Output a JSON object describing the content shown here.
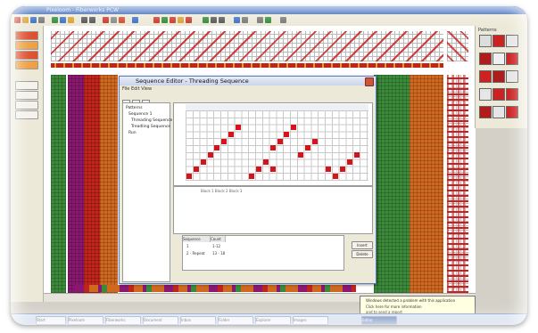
{
  "app": {
    "window_title": "Pixeloom - Fiberworks PCW",
    "accent": "#1d4fa8"
  },
  "toolbar": {
    "icons": [
      "new-icon",
      "open-icon",
      "save-icon",
      "print-icon",
      "cut-icon",
      "copy-icon",
      "paste-icon",
      "undo-icon",
      "redo-icon",
      "zoom-icon",
      "grid-icon",
      "color-icon",
      "help-icon"
    ]
  },
  "palette": {
    "heading": "Patterns",
    "colors": [
      "#cc2222",
      "#e6e6e6",
      "#b01c1c",
      "#f0f0f0"
    ]
  },
  "dialog": {
    "title": "Sequence Editor - Threading Sequence",
    "menu": "File   Edit   View",
    "tree": {
      "items": [
        "Patterns",
        "Sequence 1",
        "Threading Sequence",
        "Treadling Sequence",
        "Run"
      ]
    },
    "info_text": "Block  1  Block 2  Block 3",
    "table": {
      "headers": [
        "Sequence",
        "Count"
      ],
      "rows": [
        [
          "1",
          "1-12"
        ],
        [
          "2 - Repeat",
          "13 - 18"
        ]
      ]
    },
    "buttons": {
      "insert": "Insert",
      "delete": "Delete"
    }
  },
  "tooltip": {
    "lines": [
      "Windows detected a problem with this application",
      "Click here for more information",
      "and to send a report"
    ]
  },
  "taskbar": {
    "items": [
      "Start",
      "Pixeloom",
      "Fiberworks",
      "Document",
      "Inbox",
      "Folder",
      "Explorer",
      "Images",
      "Editor"
    ]
  }
}
